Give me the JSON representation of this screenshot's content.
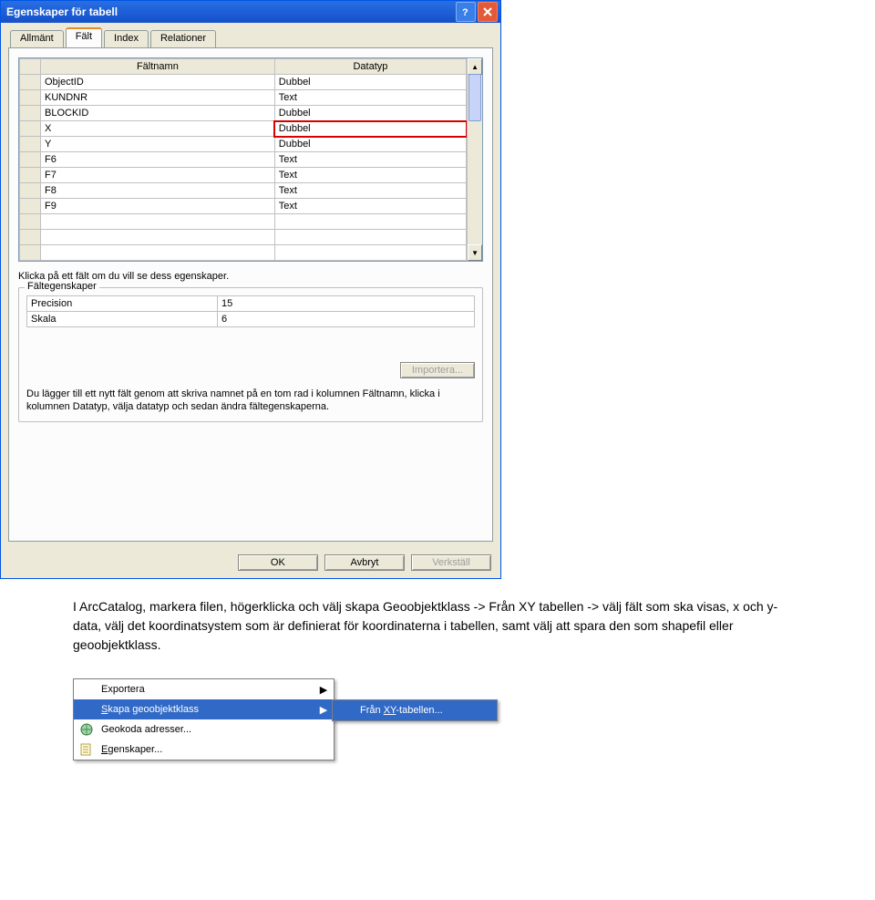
{
  "dialog": {
    "title": "Egenskaper för tabell",
    "tabs": [
      "Allmänt",
      "Fält",
      "Index",
      "Relationer"
    ],
    "active_tab": "Fält",
    "grid": {
      "col_fieldname": "Fältnamn",
      "col_datatype": "Datatyp",
      "rows": [
        {
          "name": "ObjectID",
          "type": "Dubbel"
        },
        {
          "name": "KUNDNR",
          "type": "Text"
        },
        {
          "name": "BLOCKID",
          "type": "Dubbel"
        },
        {
          "name": "X",
          "type": "Dubbel",
          "highlight": true
        },
        {
          "name": "Y",
          "type": "Dubbel"
        },
        {
          "name": "F6",
          "type": "Text"
        },
        {
          "name": "F7",
          "type": "Text"
        },
        {
          "name": "F8",
          "type": "Text"
        },
        {
          "name": "F9",
          "type": "Text"
        },
        {
          "name": "",
          "type": ""
        },
        {
          "name": "",
          "type": ""
        },
        {
          "name": "",
          "type": ""
        }
      ]
    },
    "click_hint": "Klicka på ett fält om du vill se dess egenskaper.",
    "fieldset_label": "Fältegenskaper",
    "props": [
      {
        "label": "Precision",
        "value": "15"
      },
      {
        "label": "Skala",
        "value": "6"
      }
    ],
    "import_btn": "Importera...",
    "help_text": "Du lägger till ett nytt fält genom att skriva namnet på en tom rad i kolumnen Fältnamn, klicka i kolumnen Datatyp, välja datatyp och sedan ändra fältegenskaperna.",
    "buttons": {
      "ok": "OK",
      "cancel": "Avbryt",
      "apply": "Verkställ"
    }
  },
  "doc_text": "I ArcCatalog, markera filen, högerklicka och välj skapa Geoobjektklass -> Från XY tabellen -> välj fält som ska visas, x och y-data, välj det koordinatsystem som är definierat för koordinaterna i tabellen, samt välj att spara den som shapefil eller geoobjektklass.",
  "menu": {
    "items": [
      {
        "label": "Exportera",
        "arrow": true
      },
      {
        "label": "Skapa geoobjektklass",
        "arrow": true,
        "selected": true,
        "underline_char": "S"
      },
      {
        "label": "Geokoda adresser...",
        "icon": "globe"
      },
      {
        "label": "Egenskaper...",
        "icon": "sheet",
        "underline_char": "E"
      }
    ],
    "submenu": {
      "label": "Från XY-tabellen...",
      "underline_chars": "XY"
    }
  }
}
